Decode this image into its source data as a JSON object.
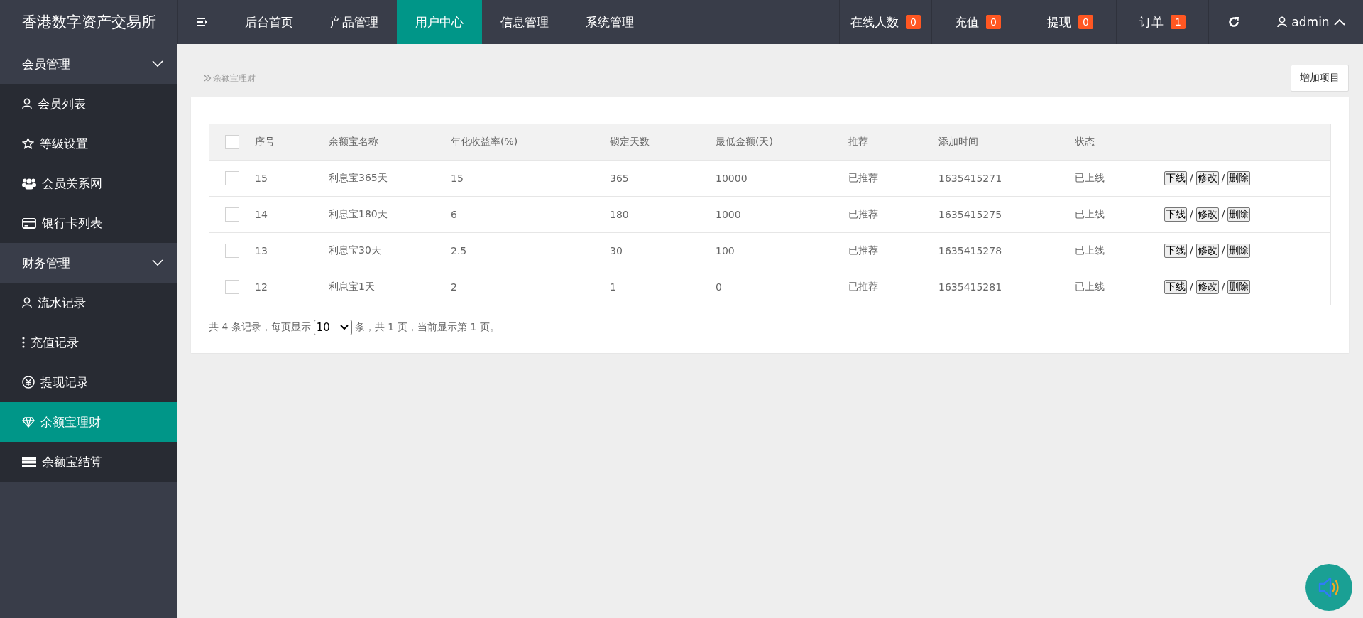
{
  "brand": "香港数字资产交易所",
  "nav": [
    {
      "label": "后台首页",
      "selected": false
    },
    {
      "label": "产品管理",
      "selected": false
    },
    {
      "label": "用户中心",
      "selected": true
    },
    {
      "label": "信息管理",
      "selected": false
    },
    {
      "label": "系统管理",
      "selected": false
    }
  ],
  "counters": [
    {
      "label": "在线人数",
      "count": "0"
    },
    {
      "label": "充值",
      "count": "0"
    },
    {
      "label": "提现",
      "count": "0"
    },
    {
      "label": "订单",
      "count": "1"
    }
  ],
  "user": {
    "name": "admin"
  },
  "sidebar": [
    {
      "label": "会员管理",
      "expanded": true,
      "children": [
        {
          "label": "会员列表",
          "selected": false
        },
        {
          "label": "等级设置",
          "selected": false
        },
        {
          "label": "会员关系网",
          "selected": false
        },
        {
          "label": "银行卡列表",
          "selected": false
        }
      ]
    },
    {
      "label": "财务管理",
      "expanded": true,
      "children": [
        {
          "label": "流水记录",
          "selected": false
        },
        {
          "label": "充值记录",
          "selected": false
        },
        {
          "label": "提现记录",
          "selected": false
        },
        {
          "label": "余额宝理财",
          "selected": true
        },
        {
          "label": "余额宝结算",
          "selected": false
        }
      ]
    }
  ],
  "breadcrumb": "余额宝理财",
  "add_button": "增加项目",
  "table": {
    "header_checked": false,
    "columns": [
      "序号",
      "余额宝名称",
      "年化收益率(%)",
      "锁定天数",
      "最低金额(天)",
      "推荐",
      "添加时间",
      "状态"
    ],
    "rows": [
      {
        "checked": false,
        "cells": [
          "15",
          "利息宝365天",
          "15",
          "365",
          "10000",
          "已推荐",
          "1635415271",
          "已上线"
        ],
        "actions": [
          {
            "kind": "button",
            "text": "下线"
          },
          {
            "kind": "sep",
            "text": "/"
          },
          {
            "kind": "button",
            "text": "修改"
          },
          {
            "kind": "sep",
            "text": "/"
          },
          {
            "kind": "button",
            "text": "删除"
          }
        ]
      },
      {
        "checked": false,
        "cells": [
          "14",
          "利息宝180天",
          "6",
          "180",
          "1000",
          "已推荐",
          "1635415275",
          "已上线"
        ],
        "actions": [
          {
            "kind": "button",
            "text": "下线"
          },
          {
            "kind": "sep",
            "text": "/"
          },
          {
            "kind": "button",
            "text": "修改"
          },
          {
            "kind": "sep",
            "text": "/"
          },
          {
            "kind": "button",
            "text": "删除"
          }
        ]
      },
      {
        "checked": false,
        "cells": [
          "13",
          "利息宝30天",
          "2.5",
          "30",
          "100",
          "已推荐",
          "1635415278",
          "已上线"
        ],
        "actions": [
          {
            "kind": "button",
            "text": "下线"
          },
          {
            "kind": "sep",
            "text": "/"
          },
          {
            "kind": "button",
            "text": "修改"
          },
          {
            "kind": "sep",
            "text": "/"
          },
          {
            "kind": "button",
            "text": "删除"
          }
        ]
      },
      {
        "checked": false,
        "cells": [
          "12",
          "利息宝1天",
          "2",
          "1",
          "0",
          "已推荐",
          "1635415281",
          "已上线"
        ],
        "actions": [
          {
            "kind": "button",
            "text": "下线"
          },
          {
            "kind": "sep",
            "text": "/"
          },
          {
            "kind": "button",
            "text": "修改"
          },
          {
            "kind": "sep",
            "text": "/"
          },
          {
            "kind": "button",
            "text": "删除"
          }
        ]
      }
    ]
  },
  "pagination": {
    "before": "共 4 条记录，每页显示",
    "page_size": "10",
    "after": "条，共 1 页，当前显示第 1 页。"
  }
}
